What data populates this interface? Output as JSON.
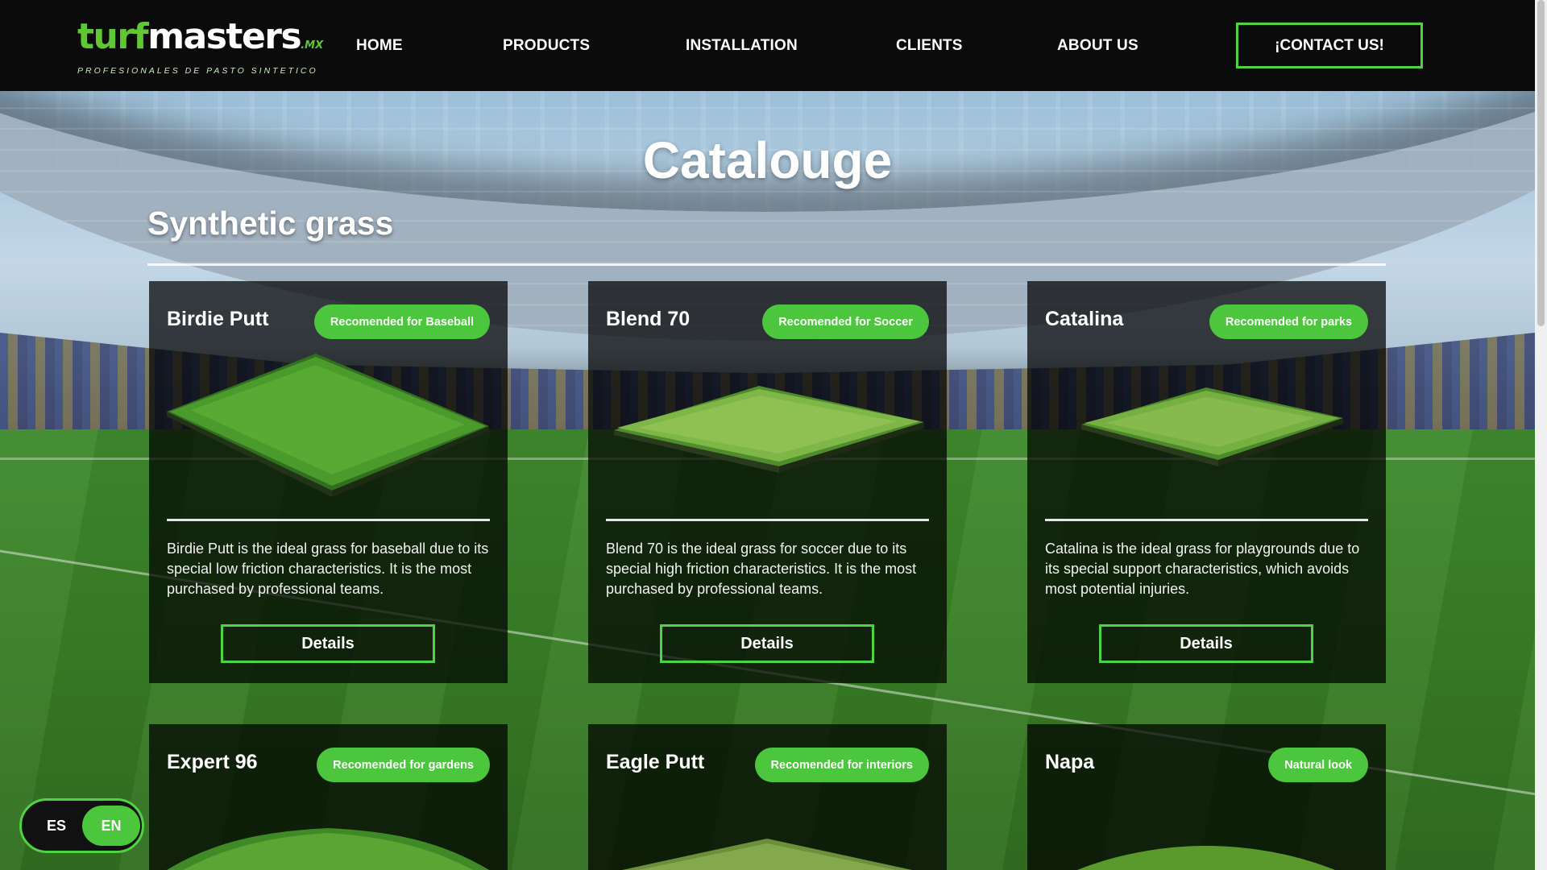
{
  "header": {
    "logo": {
      "brand_turf": "turf",
      "brand_masters": "masters",
      "brand_suffix": ".MX",
      "tagline": "PROFESIONALES DE PASTO SINTETICO"
    },
    "nav": [
      {
        "label": "HOME"
      },
      {
        "label": "PRODUCTS"
      },
      {
        "label": "INSTALLATION"
      },
      {
        "label": "CLIENTS"
      },
      {
        "label": "ABOUT US"
      }
    ],
    "contact_label": "¡CONTACT US!"
  },
  "page": {
    "title": "Catalouge",
    "section_title": "Synthetic grass"
  },
  "products": [
    {
      "name": "Birdie Putt",
      "badge": "Recomended for Baseball",
      "description": "Birdie Putt is the ideal grass for baseball due to its special low friction characteristics. It is the most purchased by professional teams.",
      "button": "Details"
    },
    {
      "name": "Blend 70",
      "badge": "Recomended for Soccer",
      "description": "Blend 70 is the ideal grass for soccer due to its special high friction characteristics. It is the most purchased by professional teams.",
      "button": "Details"
    },
    {
      "name": "Catalina",
      "badge": "Recomended for parks",
      "description": "Catalina is the ideal grass for playgrounds due to its special support characteristics, which avoids most potential injuries.",
      "button": "Details"
    },
    {
      "name": "Expert 96",
      "badge": "Recomended for gardens"
    },
    {
      "name": "Eagle Putt",
      "badge": "Recomended for interiors"
    },
    {
      "name": "Napa",
      "badge": "Natural look"
    }
  ],
  "language": {
    "es": "ES",
    "en": "EN",
    "active": "EN"
  },
  "colors": {
    "accent_green": "#4cc63c",
    "header_bg": "#0b0b0b",
    "card_bg": "rgba(0,0,0,0.72)"
  },
  "icons": {
    "turf_sample": "turf-sample-image"
  }
}
